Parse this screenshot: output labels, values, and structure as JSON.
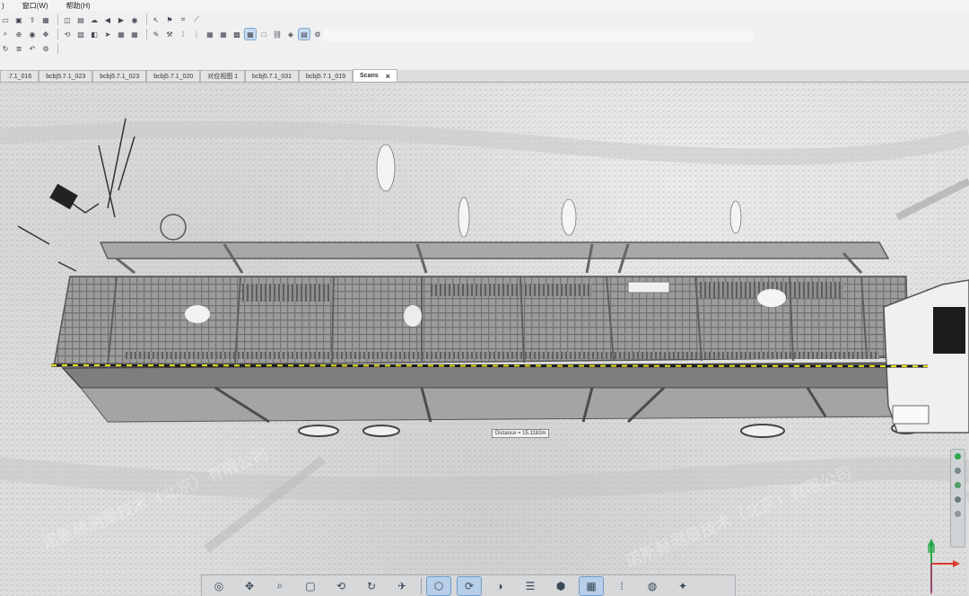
{
  "menu": {
    "window": "窗口(W)",
    "help": "帮助(H)",
    "first": ")"
  },
  "tabs": [
    {
      "label": ".7.1_016"
    },
    {
      "label": "bcbj5.7.1_023"
    },
    {
      "label": "bcbj5.7.1_023"
    },
    {
      "label": "bcbj5.7.1_020"
    },
    {
      "label": "对应视图 1"
    },
    {
      "label": "bcbj5.7.1_031"
    },
    {
      "label": "bcbj5.7.1_019"
    },
    {
      "label": "Scans",
      "close": "×"
    }
  ],
  "measurement": {
    "text": "Distance = 15.1182m"
  },
  "watermark": {
    "text": "诺斯赫测量技术（北京）有限公司"
  },
  "toolbar_icons": {
    "row1": [
      "open-icon",
      "save-icon",
      "export-icon",
      "table-icon",
      "layout-icon",
      "window-icon",
      "cloud-icon",
      "back-icon",
      "forward-icon",
      "camera-icon",
      "pointer-icon",
      "pin-icon",
      "tag-icon",
      "measure-icon"
    ],
    "row2": [
      "zoom-icon",
      "zoom-fit-icon",
      "camera-icon",
      "move-icon",
      "rotate-icon",
      "image-icon",
      "view-icon",
      "arrow-icon",
      "grid-icon",
      "grid-icon",
      "pen-icon",
      "tool-icon",
      "dots-icon",
      "grid-small-icon",
      "grid-medium-icon",
      "grid-large-icon",
      "grid-xl-icon",
      "table-icon",
      "square-icon",
      "link-icon",
      "cube-icon",
      "window-icon",
      "gear-icon"
    ],
    "row3": [
      "refresh-icon",
      "layers-icon",
      "undo-icon",
      "settings-icon"
    ]
  },
  "bottom_icons": [
    "orbit-icon",
    "pan-icon",
    "zoom-icon",
    "box-icon",
    "rotate-icon",
    "refresh-icon",
    "fly-icon",
    "cube-view-icon",
    "orbit-point-icon",
    "half-icon",
    "stack-icon",
    "hexagon-icon",
    "grid-icon",
    "dots-icon",
    "color-wheel-icon",
    "paint-icon"
  ],
  "colors": {
    "measure_line_dark": "#1b1b1b",
    "measure_line_accent": "#e6e018",
    "axis_x": "#d83a2a",
    "axis_y": "#2aa84a",
    "axis_z": "#2f5fd1"
  }
}
